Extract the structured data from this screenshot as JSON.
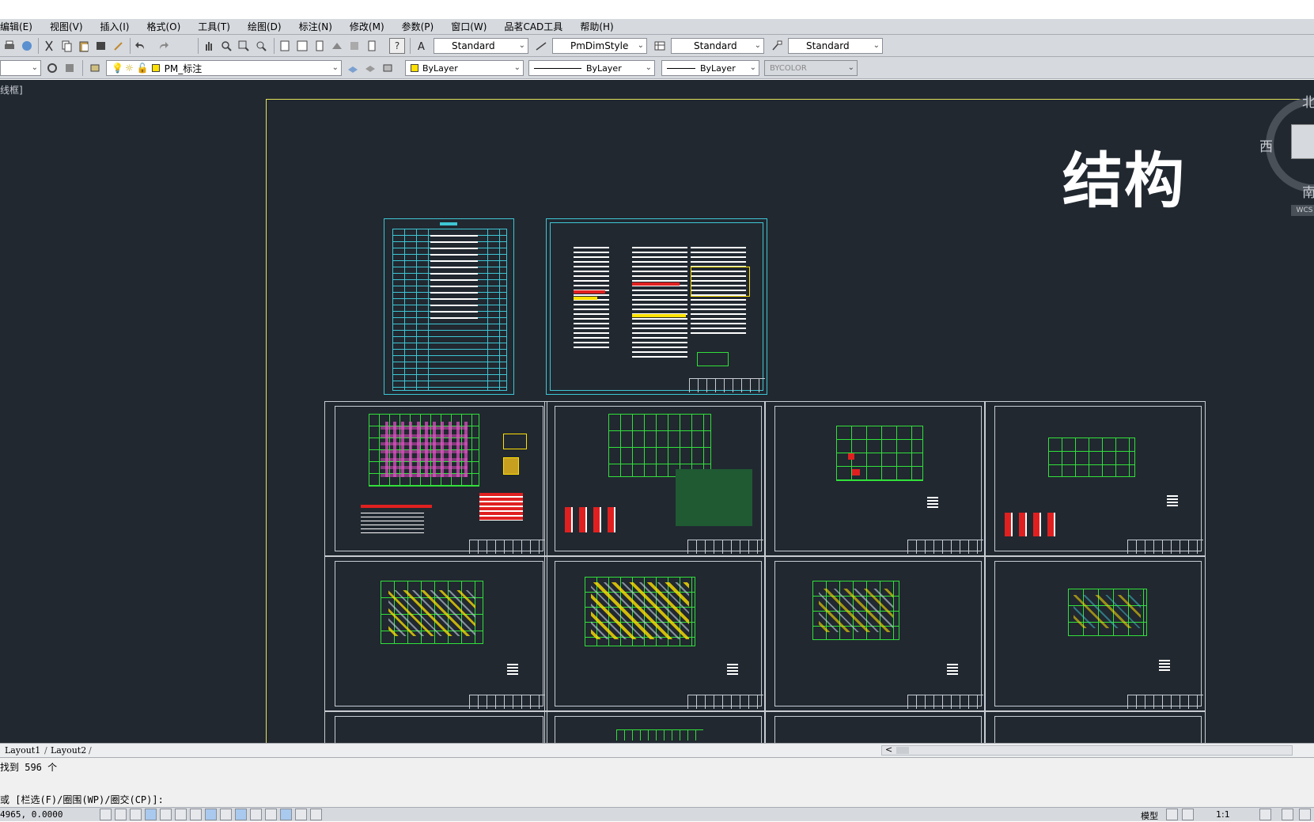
{
  "menu": [
    "编辑(E)",
    "视图(V)",
    "插入(I)",
    "格式(O)",
    "工具(T)",
    "绘图(D)",
    "标注(N)",
    "修改(M)",
    "参数(P)",
    "窗口(W)",
    "品茗CAD工具",
    "帮助(H)"
  ],
  "toolbar": {
    "text_style": "Standard",
    "dim_style": "PmDimStyle",
    "table_style": "Standard",
    "mleader_style": "Standard",
    "layer_name": "PM_标注",
    "color": "ByLayer",
    "linetype": "ByLayer",
    "lineweight": "ByLayer",
    "plot_style": "BYCOLOR"
  },
  "canvas": {
    "viewport_label": "线框]",
    "title_text": "结构",
    "compass": {
      "north": "北",
      "west": "西",
      "south": "南",
      "wcs": "WCS"
    }
  },
  "tabs": {
    "layout1": "Layout1",
    "layout2": "Layout2",
    "scroll_left": "<"
  },
  "command": {
    "line1": "找到 596 个",
    "line2": "或 [栏选(F)/圈围(WP)/圈交(CP)]:"
  },
  "status": {
    "coords": "4965, 0.0000",
    "model": "模型",
    "scale": "1:1"
  },
  "colors": {
    "canvas_bg": "#212830",
    "frame": "#e4e35a",
    "cyan": "#3ec6d4",
    "green": "#31e03a",
    "red": "#e02020",
    "yellow": "#ffe000"
  }
}
